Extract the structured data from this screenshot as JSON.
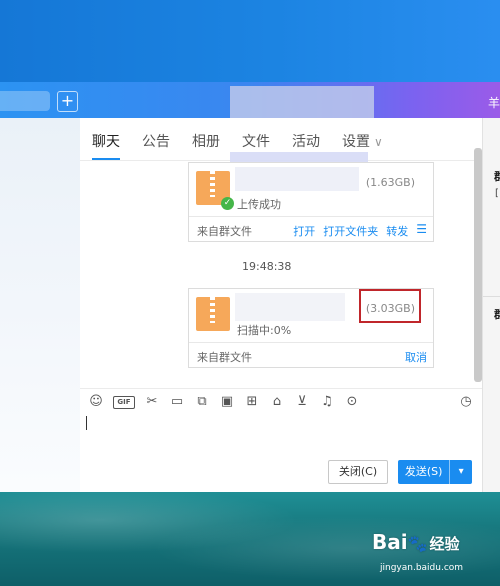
{
  "window": {
    "title_right": "羊",
    "add_button": "+"
  },
  "tabs": [
    {
      "label": "聊天"
    },
    {
      "label": "公告"
    },
    {
      "label": "相册"
    },
    {
      "label": "文件"
    },
    {
      "label": "活动"
    },
    {
      "label": "设置"
    }
  ],
  "messages": {
    "file1": {
      "size": "(1.63GB)",
      "status": "上传成功",
      "source": "来自群文件",
      "actions": [
        "打开",
        "打开文件夹",
        "转发"
      ]
    },
    "timestamp": "19:48:38",
    "file2": {
      "size": "(3.03GB)",
      "status": "扫描中:0%",
      "source": "来自群文件",
      "actions": [
        "取消"
      ]
    }
  },
  "toolbar": {
    "icons": [
      "emoji-icon",
      "gif-icon",
      "scissors-icon",
      "folder-icon",
      "screenshot-icon",
      "image-icon",
      "gift-box-icon",
      "present-icon",
      "red-envelope-icon",
      "bell-icon",
      "more-icon"
    ],
    "gif_label": "GIF",
    "history_icon": "history-icon"
  },
  "composer": {
    "close_label": "关闭(C)",
    "send_label": "发送(S)",
    "send_dropdown": "▾"
  },
  "side_panel": {
    "label1": "群",
    "sub1": "[",
    "label2": "群"
  },
  "watermark": {
    "brand": "Bai",
    "brand_suffix": "经验",
    "url": "jingyan.baidu.com"
  },
  "colors": {
    "accent": "#1a8cf0",
    "highlight": "#c0262b",
    "zip": "#f6a85a",
    "success": "#45b649"
  }
}
